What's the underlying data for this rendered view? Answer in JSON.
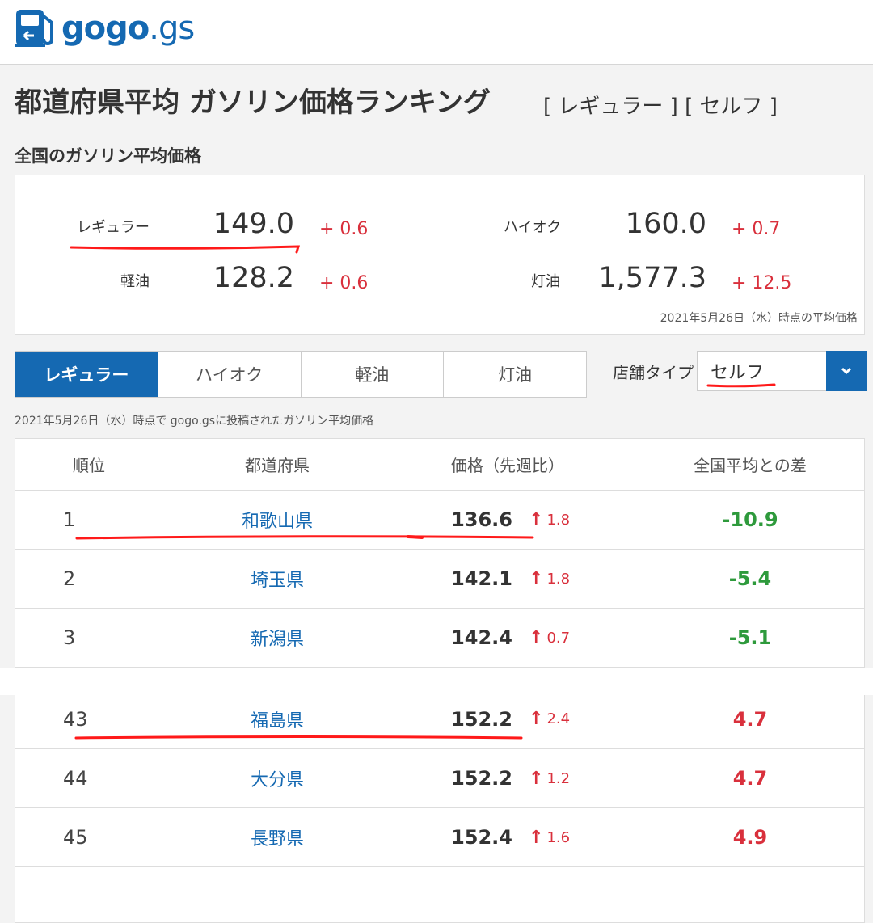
{
  "brand": {
    "name_main": "gogo",
    "name_suffix": ".gs",
    "accent": "#1569b2",
    "up_color": "#d9303c",
    "down_color": "#2e9a3c"
  },
  "page": {
    "title": "都道府県平均 ガソリン価格ランキング",
    "tags": "[ レギュラー ] [ セルフ ]",
    "national_heading": "全国のガソリン平均価格"
  },
  "national": {
    "regular": {
      "label": "レギュラー",
      "price": "149.0",
      "diff": "+ 0.6"
    },
    "highoctane": {
      "label": "ハイオク",
      "price": "160.0",
      "diff": "+ 0.7"
    },
    "diesel": {
      "label": "軽油",
      "price": "128.2",
      "diff": "+ 0.6"
    },
    "kerosene": {
      "label": "灯油",
      "price": "1,577.3",
      "diff": "+ 12.5"
    },
    "note": "2021年5月26日（水）時点の平均価格"
  },
  "tabs": [
    {
      "label": "レギュラー",
      "active": true
    },
    {
      "label": "ハイオク",
      "active": false
    },
    {
      "label": "軽油",
      "active": false
    },
    {
      "label": "灯油",
      "active": false
    }
  ],
  "store_type": {
    "label": "店舗タイプ",
    "value": "セルフ",
    "icon": "chevron-down-icon"
  },
  "table_note": "2021年5月26日（水）時点で gogo.gsに投稿されたガソリン平均価格",
  "table": {
    "headers": [
      "順位",
      "都道府県",
      "価格（先週比）",
      "全国平均との差"
    ],
    "rows": [
      {
        "rank": "1",
        "pref": "和歌山県",
        "price": "136.6",
        "change": "1.8",
        "diff": "-10.9",
        "sign": "neg"
      },
      {
        "rank": "2",
        "pref": "埼玉県",
        "price": "142.1",
        "change": "1.8",
        "diff": "-5.4",
        "sign": "neg"
      },
      {
        "rank": "3",
        "pref": "新潟県",
        "price": "142.4",
        "change": "0.7",
        "diff": "-5.1",
        "sign": "neg"
      },
      {
        "rank": "43",
        "pref": "福島県",
        "price": "152.2",
        "change": "2.4",
        "diff": "4.7",
        "sign": "pos"
      },
      {
        "rank": "44",
        "pref": "大分県",
        "price": "152.2",
        "change": "1.2",
        "diff": "4.7",
        "sign": "pos"
      },
      {
        "rank": "45",
        "pref": "長野県",
        "price": "152.4",
        "change": "1.6",
        "diff": "4.9",
        "sign": "pos"
      }
    ]
  },
  "annotation_color": "#ff1a1a"
}
